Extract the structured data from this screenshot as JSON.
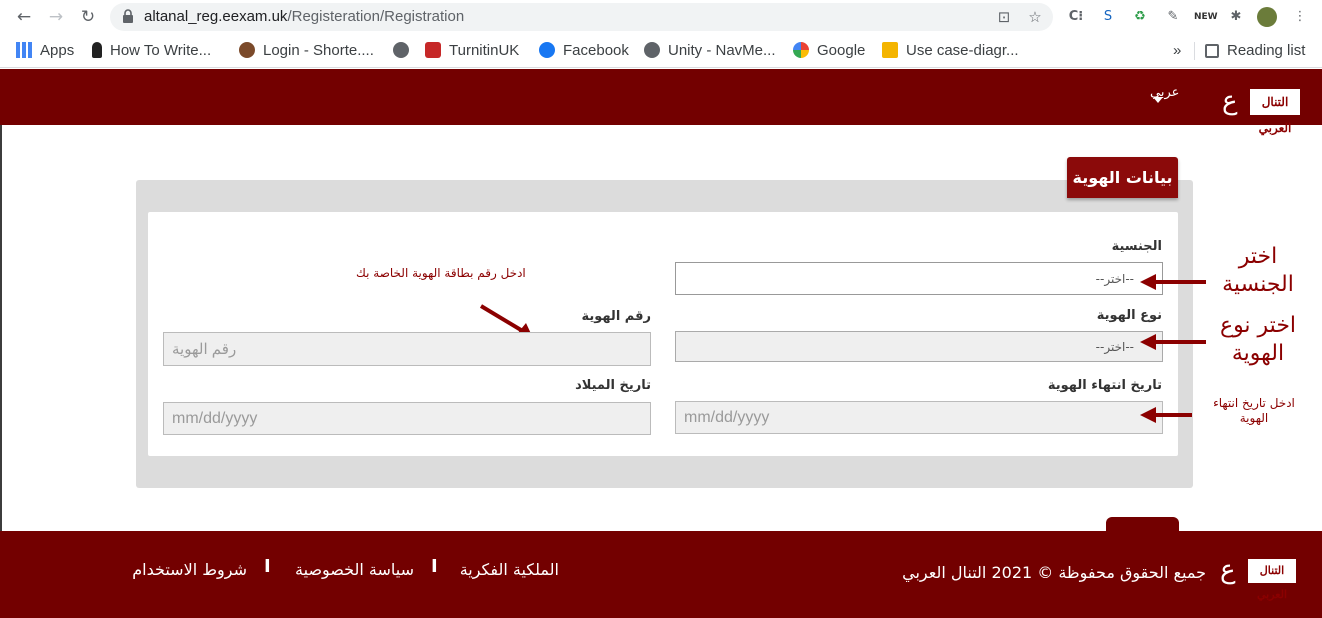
{
  "browser": {
    "url_host": "altanal_reg.eexam.uk",
    "url_path": "/Registeration/Registration",
    "bookmarks": [
      {
        "label": "Apps",
        "icon": "apps-grid-icon"
      },
      {
        "label": "How To Write...",
        "icon": "keyhole-icon"
      },
      {
        "label": "Login - Shorte....",
        "icon": "burger-icon"
      },
      {
        "label": "",
        "icon": "globe-icon"
      },
      {
        "label": "TurnitinUK",
        "icon": "turnitin-icon"
      },
      {
        "label": "Facebook",
        "icon": "facebook-icon"
      },
      {
        "label": "Unity - NavMe...",
        "icon": "globe-icon"
      },
      {
        "label": "Google",
        "icon": "google-icon"
      },
      {
        "label": "Use case-diagr...",
        "icon": "bookmark-page-icon"
      }
    ],
    "more_bookmarks": "»",
    "reading_list": "Reading list"
  },
  "header": {
    "logo_text": "التنال العربي",
    "language": "عربي"
  },
  "section": {
    "title": "بيانات الهوية"
  },
  "form": {
    "nationality_label": "الجنسية",
    "nationality_value": "--اختر--",
    "id_type_label": "نوع الهوية",
    "id_type_value": "--اختر--",
    "id_number_label": "رقم الهوية",
    "id_number_placeholder": "رقم الهوية",
    "id_number_hint": "ادخل رقم بطاقة الهوية الخاصة بك",
    "id_expiry_label": "تاريخ انتهاء الهوية",
    "id_expiry_placeholder": "mm/dd/yyyy",
    "birth_date_label": "تاريخ الميلاد",
    "birth_date_placeholder": "mm/dd/yyyy"
  },
  "annotations": {
    "choose_nationality": "اختر الجنسية",
    "choose_id_type": "اختر نوع الهوية",
    "enter_expiry": "ادخل تاريخ انتهاء الهوية"
  },
  "footer": {
    "copyright": "جميع الحقوق محفوظة © 2021 التنال العربي",
    "links": [
      "الملكية الفكرية",
      "سياسة الخصوصية",
      "شروط الاستخدام"
    ],
    "separator": "I"
  },
  "colors": {
    "brand": "#730000",
    "accent": "#8b0000"
  }
}
